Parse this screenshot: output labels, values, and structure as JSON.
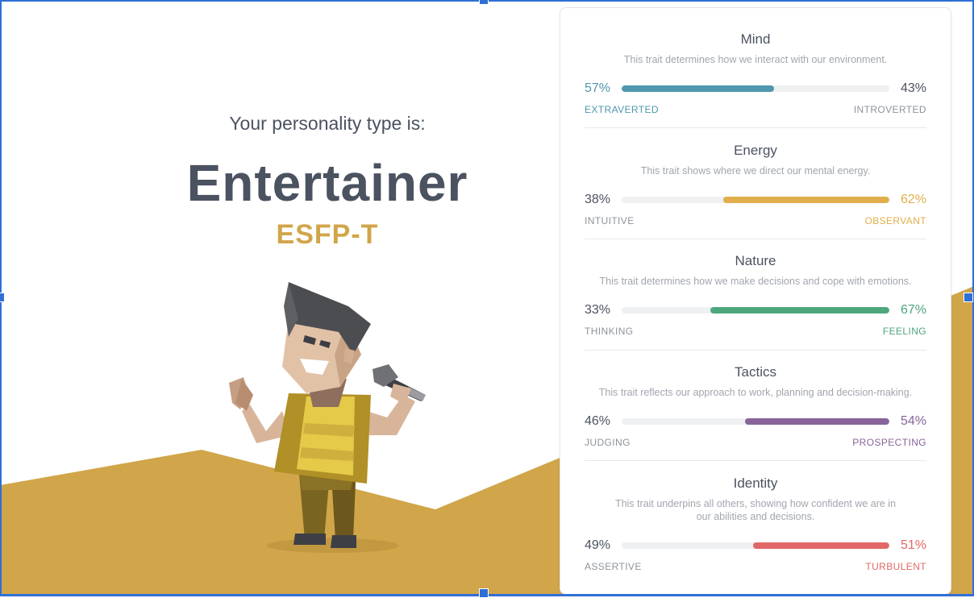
{
  "result": {
    "subtitle": "Your personality type is:",
    "type_name": "Entertainer",
    "type_code": "ESFP-T"
  },
  "colors": {
    "accent_gold": "#d1a54a",
    "heading": "#4b5260",
    "mind": "#4f97ae",
    "energy": "#e0ae4c",
    "nature": "#4ea67c",
    "tactics": "#88649a",
    "identity": "#e26868",
    "neutral": "#4b5260"
  },
  "traits": [
    {
      "title": "Mind",
      "description": "This trait determines how we interact with our environment.",
      "left_pct": "57%",
      "right_pct": "43%",
      "left_label": "EXTRAVERTED",
      "right_label": "INTROVERTED",
      "dominant": "left",
      "dominant_value": 0.57,
      "color": "#4f97ae"
    },
    {
      "title": "Energy",
      "description": "This trait shows where we direct our mental energy.",
      "left_pct": "38%",
      "right_pct": "62%",
      "left_label": "INTUITIVE",
      "right_label": "OBSERVANT",
      "dominant": "right",
      "dominant_value": 0.62,
      "color": "#e0ae4c"
    },
    {
      "title": "Nature",
      "description": "This trait determines how we make decisions and cope with emotions.",
      "left_pct": "33%",
      "right_pct": "67%",
      "left_label": "THINKING",
      "right_label": "FEELING",
      "dominant": "right",
      "dominant_value": 0.67,
      "color": "#4ea67c"
    },
    {
      "title": "Tactics",
      "description": "This trait reflects our approach to work, planning and decision-making.",
      "left_pct": "46%",
      "right_pct": "54%",
      "left_label": "JUDGING",
      "right_label": "PROSPECTING",
      "dominant": "right",
      "dominant_value": 0.54,
      "color": "#88649a"
    },
    {
      "title": "Identity",
      "description": "This trait underpins all others, showing how confident we are in our abilities and decisions.",
      "left_pct": "49%",
      "right_pct": "51%",
      "left_label": "ASSERTIVE",
      "right_label": "TURBULENT",
      "dominant": "right",
      "dominant_value": 0.51,
      "color": "#e26868"
    }
  ]
}
